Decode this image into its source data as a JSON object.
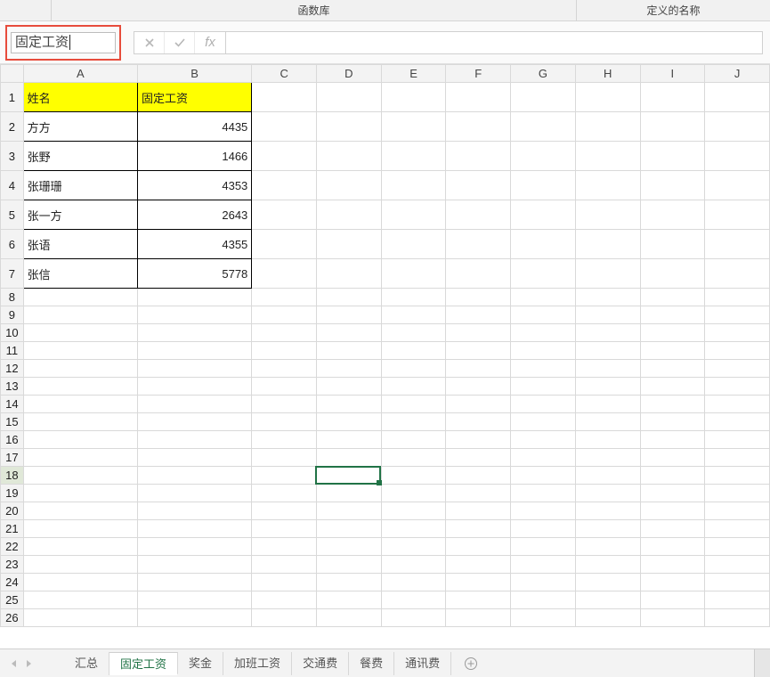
{
  "ribbon": {
    "group_function_library": "函数库",
    "group_defined_names": "定义的名称"
  },
  "formula_bar": {
    "name_box_value": "固定工资",
    "cancel_title": "取消",
    "enter_title": "输入",
    "fx_label": "fx",
    "formula_value": ""
  },
  "grid": {
    "columns": [
      "A",
      "B",
      "C",
      "D",
      "E",
      "F",
      "G",
      "H",
      "I",
      "J"
    ],
    "header_row": {
      "a": "姓名",
      "b": "固定工资"
    },
    "rows": [
      {
        "a": "方方",
        "b": "4435"
      },
      {
        "a": "张野",
        "b": "1466"
      },
      {
        "a": "张珊珊",
        "b": "4353"
      },
      {
        "a": "张一方",
        "b": "2643"
      },
      {
        "a": "张语",
        "b": "4355"
      },
      {
        "a": "张信",
        "b": "5778"
      }
    ],
    "active_cell": "D18",
    "active_col": "D",
    "active_row": "18"
  },
  "tabs": {
    "items": [
      {
        "label": "汇总"
      },
      {
        "label": "固定工资"
      },
      {
        "label": "奖金"
      },
      {
        "label": "加班工资"
      },
      {
        "label": "交通费"
      },
      {
        "label": "餐费"
      },
      {
        "label": "通讯费"
      }
    ],
    "active_index": 1,
    "add_title": "新工作表"
  }
}
